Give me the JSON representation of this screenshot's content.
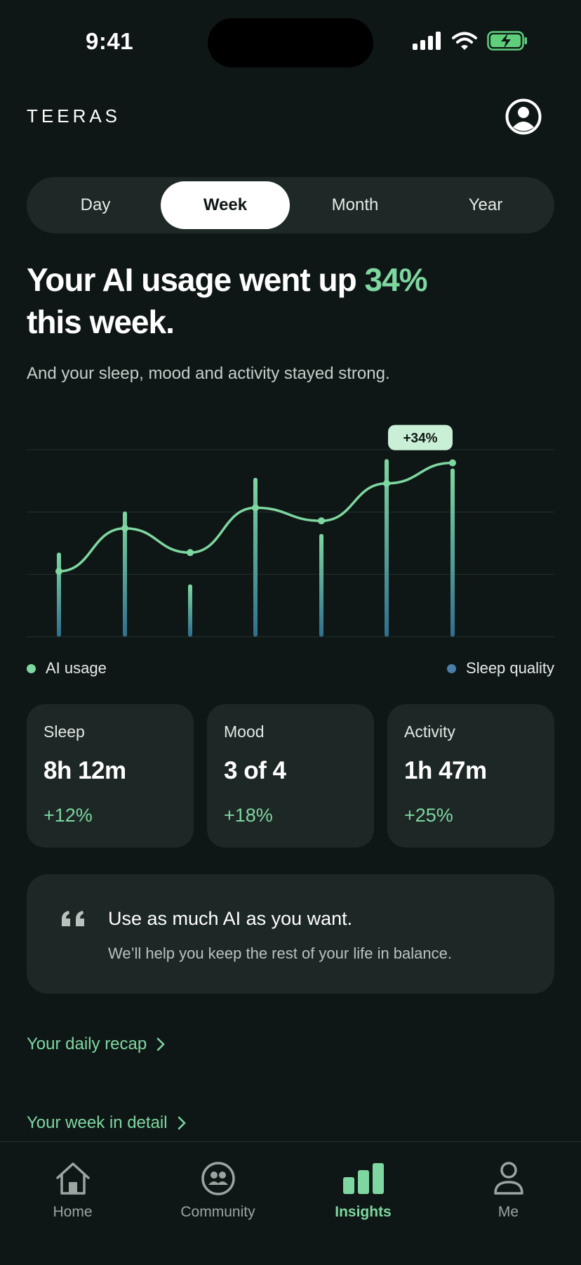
{
  "status": {
    "time": "9:41"
  },
  "header": {
    "brand": "TEERAS"
  },
  "segments": {
    "items": [
      "Day",
      "Week",
      "Month",
      "Year"
    ],
    "selected": "Week"
  },
  "headline": {
    "part1": "Your AI usage went up ",
    "highlight": "34%",
    "part2": "this week.",
    "subhead": "And your sleep, mood and activity stayed strong."
  },
  "chart_data": {
    "type": "line",
    "x": [
      "1",
      "2",
      "3",
      "4",
      "5",
      "6",
      "7"
    ],
    "series": [
      {
        "name": "AI usage",
        "values": [
          35,
          58,
          45,
          69,
          62,
          82,
          93
        ],
        "color": "#7ed7a0",
        "style": "line"
      },
      {
        "name": "Sleep quality",
        "values": [
          45,
          67,
          28,
          85,
          55,
          95,
          90
        ],
        "color": "#4a7ea8",
        "style": "bars"
      }
    ],
    "ylim": [
      0,
      100
    ],
    "grid": true,
    "annotation": "+34%",
    "legend": [
      "AI usage",
      "Sleep quality"
    ]
  },
  "legend": {
    "left": "AI usage",
    "right": "Sleep quality"
  },
  "cards": [
    {
      "label": "Sleep",
      "value": "8h 12m",
      "change": "+12%"
    },
    {
      "label": "Mood",
      "value": "3 of 4",
      "change": "+18%"
    },
    {
      "label": "Activity",
      "value": "1h 47m",
      "change": "+25%"
    }
  ],
  "quote": {
    "title": "Use as much AI as you want.",
    "body": "We’ll help you keep the rest of your life in balance."
  },
  "links": {
    "daily": "Your daily recap",
    "weekly": "Your week in detail"
  },
  "tabbar": {
    "items": [
      "Home",
      "Community",
      "Insights",
      "Me"
    ],
    "active": "Insights"
  },
  "colors": {
    "background": "#0f1716",
    "accent": "#7ed7a0",
    "sleep": "#4a7ea8",
    "card": "#1d2725"
  }
}
